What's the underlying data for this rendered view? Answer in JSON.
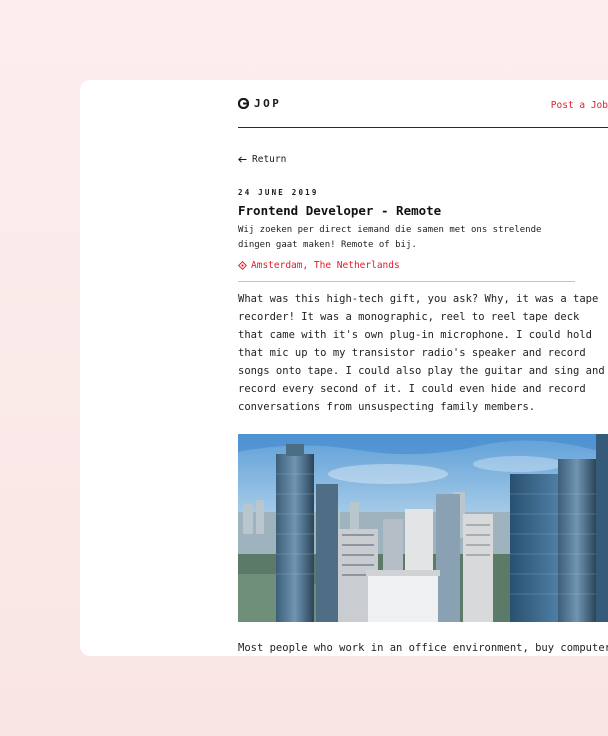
{
  "brand": {
    "name": "JOP",
    "logo_icon": "brand-logo-icon"
  },
  "nav": {
    "post_job_label": "Post a Job"
  },
  "return_label": "Return",
  "job": {
    "date": "24 JUNE 2019",
    "title": "Frontend Developer - Remote",
    "intro": "Wij zoeken per direct iemand die samen met ons strelende dingen gaat maken! Remote of bij.",
    "location": "Amsterdam, The Netherlands",
    "location_icon": "location-pin-icon"
  },
  "article": {
    "paragraph_1": "What was this high-tech gift, you ask? Why, it was a tape recorder! It was a monographic, reel to reel tape deck that came with it's own plug-in microphone. I could hold that mic up to my transistor radio's speaker and record songs onto tape. I could also play the guitar and sing and record every second of it. I could even hide and record conversations from unsuspecting family members.",
    "paragraph_2": "Most people who work in an office environment, buy computer"
  },
  "colors": {
    "accent": "#e11d2a",
    "text": "#1a1a1a",
    "background": "#fbeceb",
    "card": "#ffffff"
  }
}
